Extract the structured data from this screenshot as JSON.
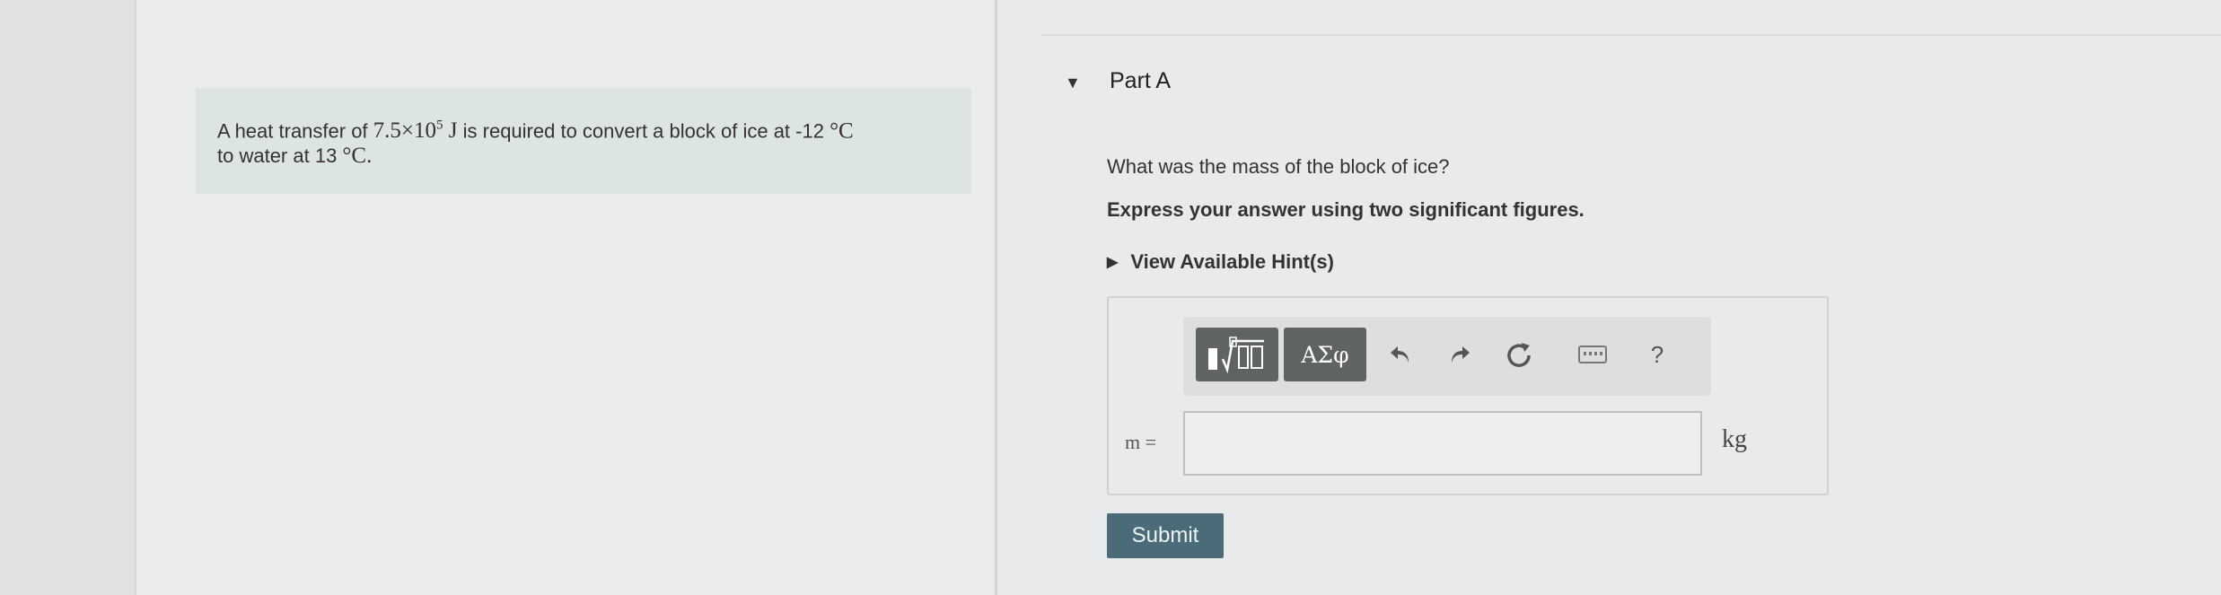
{
  "problem": {
    "text_before": "A heat transfer of ",
    "energy_mantissa": "7.5",
    "energy_times": "×10",
    "energy_exponent": "5",
    "energy_unit": " J",
    "text_middle": " is required to convert a block of ice at -12 ",
    "temp1_unit": "°C",
    "text_line2": "to water at 13 ",
    "temp2_unit": "°C",
    "period": "."
  },
  "part": {
    "title": "Part A",
    "question": "What was the mass of the block of ice?",
    "instruction": "Express your answer using two significant figures.",
    "hint_label": "View Available Hint(s)"
  },
  "toolbar": {
    "templates_icon": "templates-icon",
    "greek_label": "ΑΣφ",
    "undo_icon": "undo-icon",
    "redo_icon": "redo-icon",
    "reset_icon": "reset-icon",
    "keyboard_icon": "keyboard-icon",
    "help_label": "?"
  },
  "answer": {
    "variable_label": "m =",
    "value": "",
    "unit": "kg"
  },
  "submit_label": "Submit",
  "colors": {
    "problem_bg": "#dde5e1",
    "toolbar_button": "#5f6364",
    "submit_bg": "#4c6b78"
  }
}
